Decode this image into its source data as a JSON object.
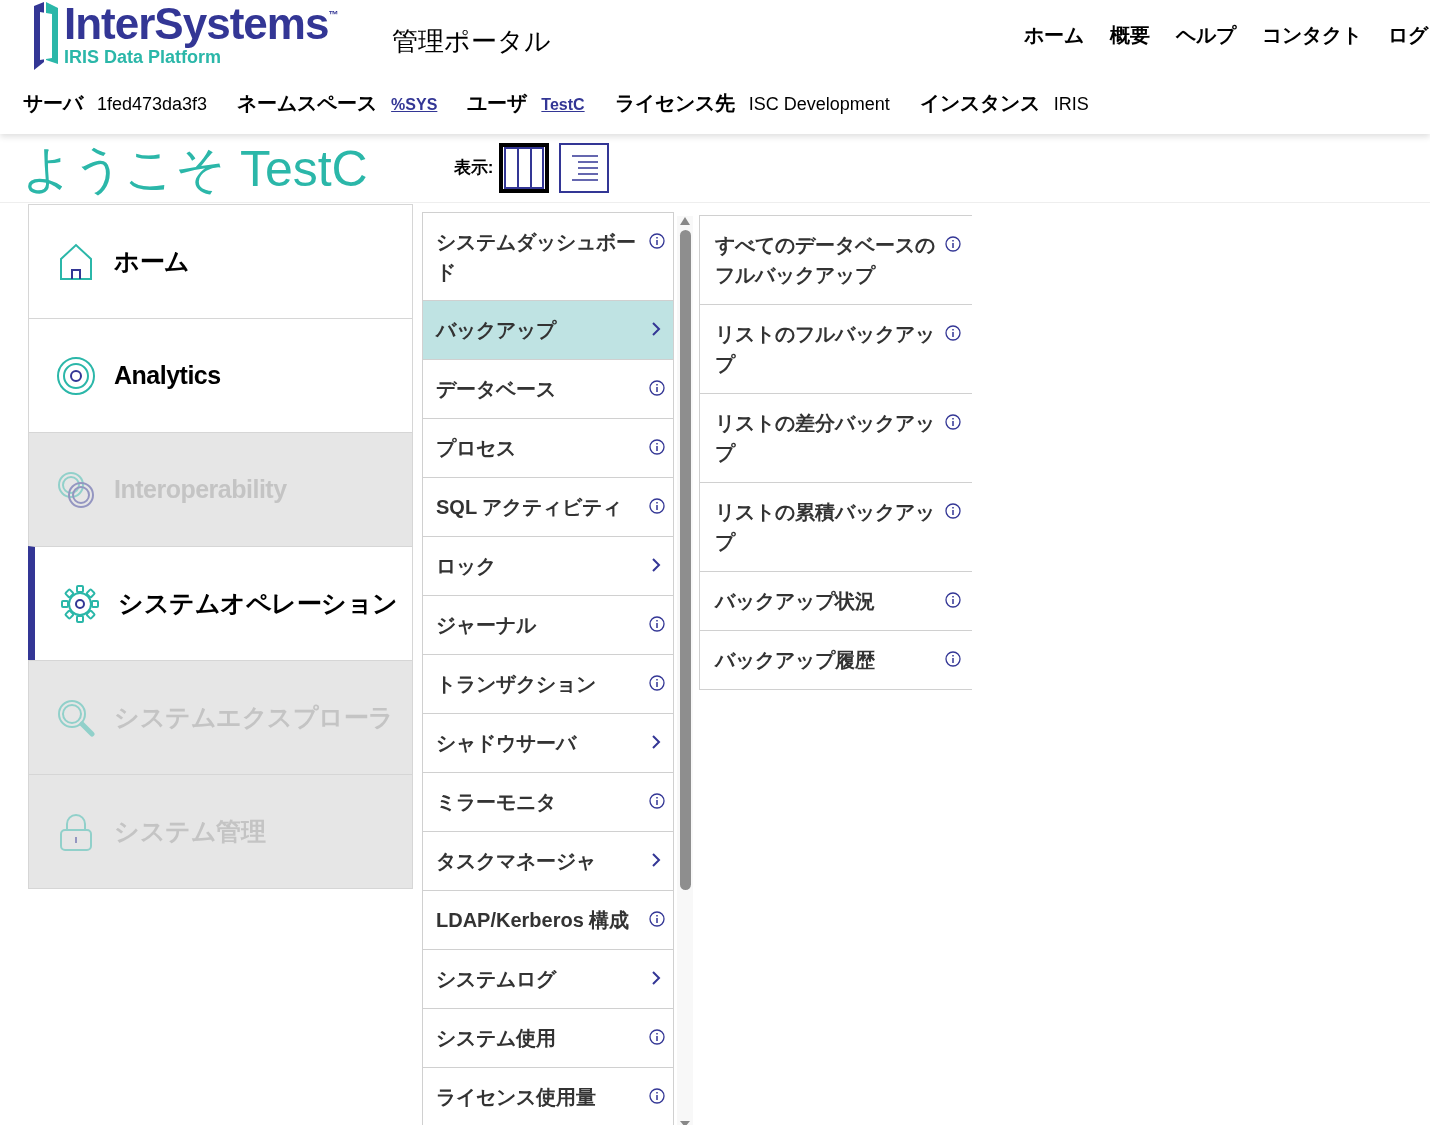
{
  "logo": {
    "name": "InterSystems",
    "tm": "™",
    "subtitle": "IRIS Data Platform"
  },
  "title": "管理ポータル",
  "top_nav": [
    "ホーム",
    "概要",
    "ヘルプ",
    "コンタクト",
    "ログ"
  ],
  "info": [
    {
      "label": "サーバ",
      "value": "1fed473da3f3",
      "kind": "text"
    },
    {
      "label": "ネームスペース",
      "value": "%SYS",
      "kind": "link"
    },
    {
      "label": "ユーザ",
      "value": "TestC",
      "kind": "link"
    },
    {
      "label": "ライセンス先",
      "value": "ISC Development",
      "kind": "text"
    },
    {
      "label": "インスタンス",
      "value": "IRIS",
      "kind": "text"
    }
  ],
  "welcome": "ようこそ TestC",
  "view": {
    "label": "表示:",
    "options": [
      {
        "kind": "columns",
        "selected": true
      },
      {
        "kind": "list",
        "selected": false
      }
    ]
  },
  "categories": [
    {
      "label": "ホーム",
      "kind": "home",
      "selected": false,
      "disabled": false
    },
    {
      "label": "Analytics",
      "kind": "target",
      "selected": false,
      "disabled": false
    },
    {
      "label": "Interoperability",
      "kind": "rings",
      "selected": false,
      "disabled": true
    },
    {
      "label": "システムオペレーション",
      "kind": "gear",
      "selected": true,
      "disabled": false
    },
    {
      "label": "システムエクスプローラ",
      "kind": "search",
      "selected": false,
      "disabled": true
    },
    {
      "label": "システム管理",
      "kind": "lock",
      "selected": false,
      "disabled": true
    }
  ],
  "menu": [
    {
      "label": "システムダッシュボード",
      "kind": "info",
      "selected": false
    },
    {
      "label": "バックアップ",
      "kind": "submenu",
      "selected": true
    },
    {
      "label": "データベース",
      "kind": "info",
      "selected": false
    },
    {
      "label": "プロセス",
      "kind": "info",
      "selected": false
    },
    {
      "label": "SQL アクティビティ",
      "kind": "info",
      "selected": false
    },
    {
      "label": "ロック",
      "kind": "submenu",
      "selected": false
    },
    {
      "label": "ジャーナル",
      "kind": "info",
      "selected": false
    },
    {
      "label": "トランザクション",
      "kind": "info",
      "selected": false
    },
    {
      "label": "シャドウサーバ",
      "kind": "submenu",
      "selected": false
    },
    {
      "label": "ミラーモニタ",
      "kind": "info",
      "selected": false
    },
    {
      "label": "タスクマネージャ",
      "kind": "submenu",
      "selected": false
    },
    {
      "label": "LDAP/Kerberos 構成",
      "kind": "info",
      "selected": false
    },
    {
      "label": "システムログ",
      "kind": "submenu",
      "selected": false
    },
    {
      "label": "システム使用",
      "kind": "info",
      "selected": false
    },
    {
      "label": "ライセンス使用量",
      "kind": "info",
      "selected": false
    }
  ],
  "submenu": [
    {
      "label": "すべてのデータベースのフルバックアップ",
      "kind": "info"
    },
    {
      "label": "リストのフルバックアップ",
      "kind": "info"
    },
    {
      "label": "リストの差分バックアップ",
      "kind": "info"
    },
    {
      "label": "リストの累積バックアップ",
      "kind": "info"
    },
    {
      "label": "バックアップ状況",
      "kind": "info"
    },
    {
      "label": "バックアップ履歴",
      "kind": "info"
    }
  ]
}
